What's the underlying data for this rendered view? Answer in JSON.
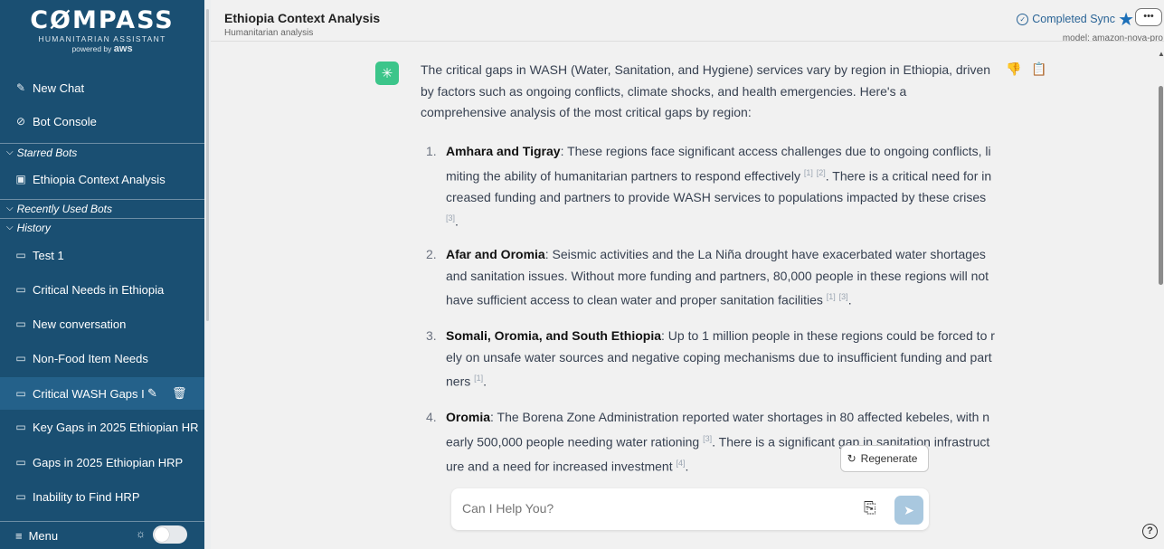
{
  "sidebar": {
    "logo_main": "CØMPASS",
    "logo_sub": "HUMANITARIAN ASSISTANT",
    "logo_powered": "powered by",
    "logo_brand": "aws",
    "new_chat": "New Chat",
    "bot_console": "Bot Console",
    "starred_bots_label": "Starred Bots",
    "starred_bot": "Ethiopia Context Analysis",
    "recent_bots_label": "Recently Used Bots",
    "history_label": "History",
    "history": [
      "Test 1",
      "Critical Needs in Ethiopia",
      "New conversation",
      "Non-Food Item Needs",
      "Critical WASH Gaps I",
      "Key Gaps in 2025 Ethiopian HR",
      "Gaps in 2025 Ethiopian HRP",
      "Inability to Find HRP"
    ],
    "menu_label": "Menu"
  },
  "header": {
    "title": "Ethiopia Context Analysis",
    "subtitle": "Humanitarian analysis",
    "sync_status": "Completed Sync",
    "more_label": "•••",
    "model": "model: amazon-nova-pro"
  },
  "message": {
    "intro": "The critical gaps in WASH (Water, Sanitation, and Hygiene) services vary by region in Ethiopia, driven by factors such as ongoing conflicts, climate shocks, and health emergencies. Here's a comprehensive analysis of the most critical gaps by region:",
    "items": [
      {
        "num": "1.",
        "bold": "Amhara and Tigray",
        "text": ": These regions face significant access challenges due to ongoing conflicts, limiting the ability of humanitarian partners to respond effectively ",
        "cite1": "[1]",
        "cite2": "[2]",
        "text2": ". There is a critical need for increased funding and partners to provide WASH services to populations impacted by these crises ",
        "cite3": "[3]",
        "end": "."
      },
      {
        "num": "2.",
        "bold": "Afar and Oromia",
        "text": ": Seismic activities and the La Niña drought have exacerbated water shortages and sanitation issues. Without more funding and partners, 80,000 people in these regions will not have sufficient access to clean water and proper sanitation facilities ",
        "cite1": "[1]",
        "cite2": "[3]",
        "end": "."
      },
      {
        "num": "3.",
        "bold": "Somali, Oromia, and South Ethiopia",
        "text": ": Up to 1 million people in these regions could be forced to rely on unsafe water sources and negative coping mechanisms due to insufficient funding and partners ",
        "cite1": "[1]",
        "end": "."
      },
      {
        "num": "4.",
        "bold": "Oromia",
        "text": ": The Borena Zone Administration reported water shortages in 80 affected kebeles, with nearly 500,000 people needing water rationing ",
        "cite1": "[3]",
        "text2": ". There is a significant gap in sanitation infrastructure and a need for increased investment ",
        "cite2": "[4]",
        "end": "."
      }
    ],
    "regenerate": "Regenerate"
  },
  "input": {
    "placeholder": "Can I Help You?"
  },
  "help": "?",
  "colors": {
    "sidebar_bg": "#1a4f72",
    "accent": "#1b6fb8",
    "bot_icon": "#3cc58a"
  }
}
